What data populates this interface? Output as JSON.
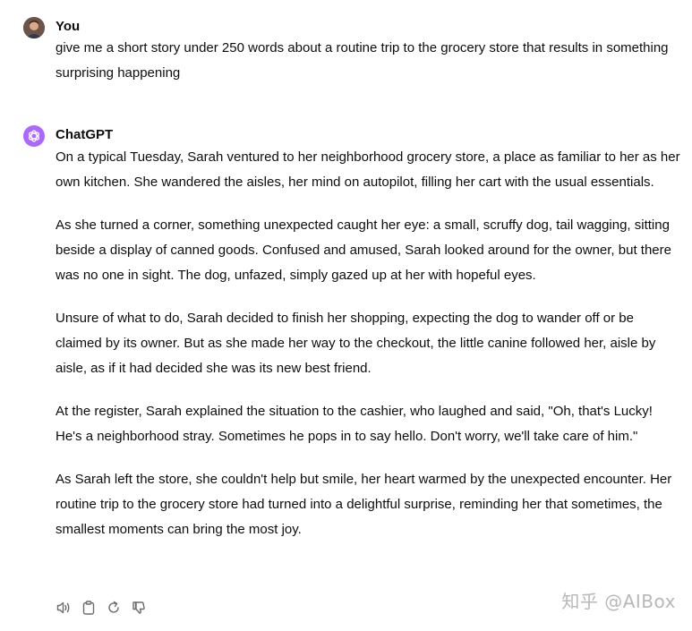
{
  "user_message": {
    "author": "You",
    "text": "give me a short story under 250 words about a routine trip to the grocery store that results in something surprising happening"
  },
  "assistant_message": {
    "author": "ChatGPT",
    "paragraphs": [
      "On a typical Tuesday, Sarah ventured to her neighborhood grocery store, a place as familiar to her as her own kitchen. She wandered the aisles, her mind on autopilot, filling her cart with the usual essentials.",
      "As she turned a corner, something unexpected caught her eye: a small, scruffy dog, tail wagging, sitting beside a display of canned goods. Confused and amused, Sarah looked around for the owner, but there was no one in sight. The dog, unfazed, simply gazed up at her with hopeful eyes.",
      "Unsure of what to do, Sarah decided to finish her shopping, expecting the dog to wander off or be claimed by its owner. But as she made her way to the checkout, the little canine followed her, aisle by aisle, as if it had decided she was its new best friend.",
      "At the register, Sarah explained the situation to the cashier, who laughed and said, \"Oh, that's Lucky! He's a neighborhood stray. Sometimes he pops in to say hello. Don't worry, we'll take care of him.\"",
      "As Sarah left the store, she couldn't help but smile, her heart warmed by the unexpected encounter. Her routine trip to the grocery store had turned into a delightful surprise, reminding her that sometimes, the smallest moments can bring the most joy."
    ]
  },
  "actions": {
    "icons": [
      "speaker-icon",
      "clipboard-icon",
      "regenerate-icon",
      "thumbs-down-icon"
    ]
  },
  "watermark": "知乎 @AIBox",
  "colors": {
    "text": "#0d0d0d",
    "icon": "#6b6b6b",
    "gpt_avatar": "#ab68ff",
    "watermark": "#b8b8b8"
  }
}
